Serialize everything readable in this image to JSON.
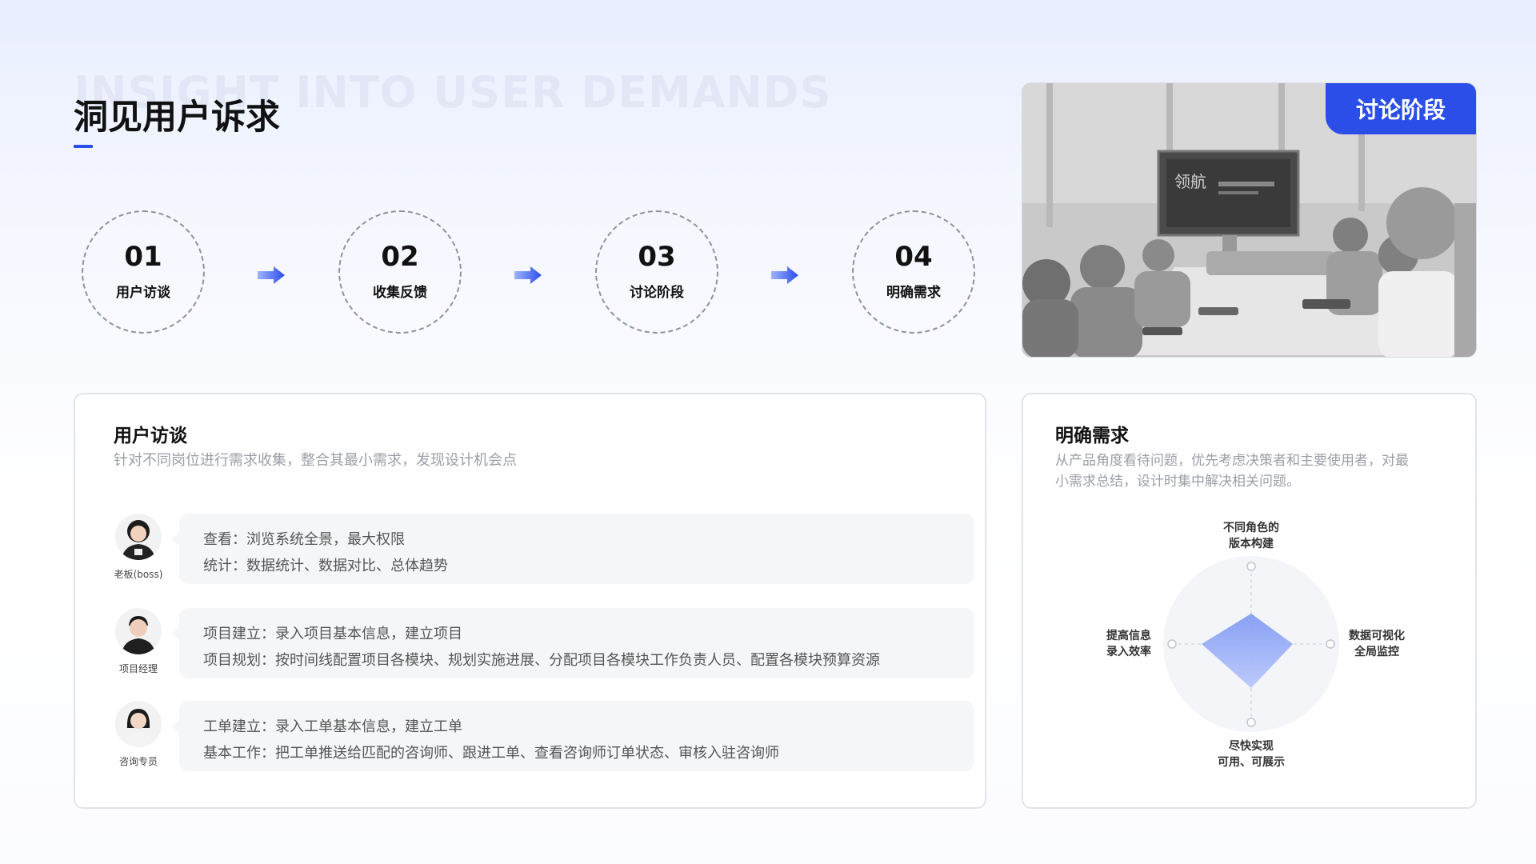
{
  "header": {
    "bg_title": "INSIGHT INTO USER DEMANDS",
    "title": "洞见用户诉求"
  },
  "steps": [
    {
      "num": "01",
      "label": "用户访谈"
    },
    {
      "num": "02",
      "label": "收集反馈"
    },
    {
      "num": "03",
      "label": "讨论阶段"
    },
    {
      "num": "04",
      "label": "明确需求"
    }
  ],
  "photo": {
    "badge": "讨论阶段"
  },
  "interview": {
    "title": "用户访谈",
    "subtitle": "针对不同岗位进行需求收集，整合其最小需求，发现设计机会点",
    "rows": [
      {
        "role": "老板(boss)",
        "lines": [
          "查看：浏览系统全景，最大权限",
          "统计：数据统计、数据对比、总体趋势"
        ]
      },
      {
        "role": "项目经理",
        "lines": [
          "项目建立：录入项目基本信息，建立项目",
          "项目规划：按时间线配置项目各模块、规划实施进展、分配项目各模块工作负责人员、配置各模块预算资源"
        ]
      },
      {
        "role": "咨询专员",
        "lines": [
          "工单建立：录入工单基本信息，建立工单",
          "基本工作：把工单推送给匹配的咨询师、跟进工单、查看咨询师订单状态、审核入驻咨询师"
        ]
      }
    ]
  },
  "requirements": {
    "title": "明确需求",
    "subtitle_line1": "从产品角度看待问题，优先考虑决策者和主要使用者，对最",
    "subtitle_line2": "小需求总结，设计时集中解决相关问题。",
    "radar": {
      "top": [
        "不同角色的",
        "版本构建"
      ],
      "right": [
        "数据可视化",
        "全局监控"
      ],
      "bottom": [
        "尽快实现",
        "可用、可展示"
      ],
      "left": [
        "提高信息",
        "录入效率"
      ]
    }
  },
  "colors": {
    "accent": "#2b4ee8",
    "radar_fill": "#8fa8f5"
  }
}
